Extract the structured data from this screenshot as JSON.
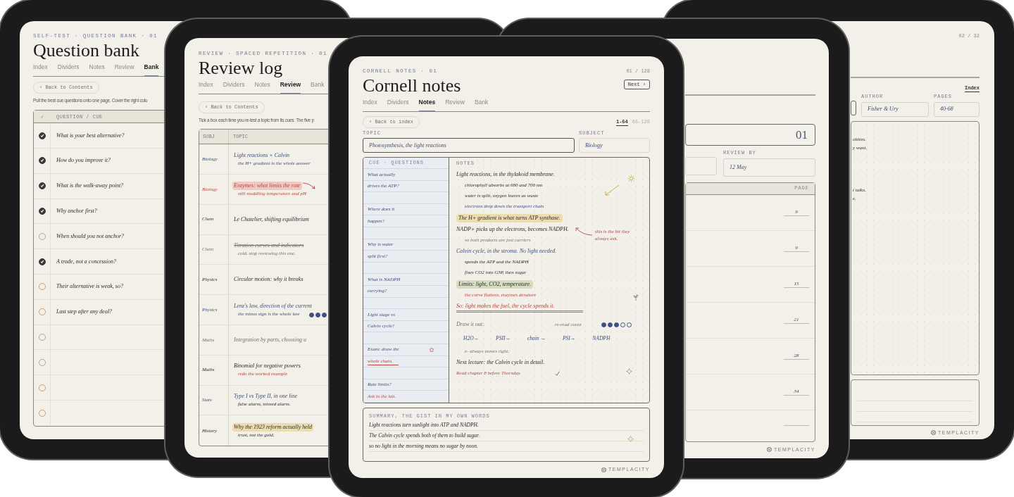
{
  "question_bank": {
    "eyebrow": "SELF-TEST · QUESTION BANK · 01",
    "title": "Question bank",
    "tabs": [
      {
        "label": "Index",
        "selected": false
      },
      {
        "label": "Dividers",
        "selected": false
      },
      {
        "label": "Notes",
        "selected": false
      },
      {
        "label": "Review",
        "selected": false
      },
      {
        "label": "Bank",
        "selected": true
      }
    ],
    "back": "‹ Back to Contents",
    "intro": "Pull the best cue questions onto one page. Cover the right colu",
    "columns": [
      "✓",
      "QUESTION / CUE"
    ],
    "rows": [
      {
        "question": "What is your best alternative?",
        "checked": true
      },
      {
        "question": "How do you improve it?",
        "checked": true
      },
      {
        "question": "What is the walk-away point?",
        "checked": true
      },
      {
        "question": "Why anchor first?",
        "checked": true
      },
      {
        "question": "When should you not anchor?",
        "checked": false
      },
      {
        "question": "A trade, not a concession?",
        "checked": true
      },
      {
        "question": "Their alternative is weak, so?",
        "checked": false
      },
      {
        "question": "Last step after any deal?",
        "checked": false
      },
      {
        "checked": false
      },
      {
        "checked": false
      },
      {
        "checked": false
      },
      {
        "checked": false
      }
    ]
  },
  "review_log": {
    "eyebrow": "REVIEW · SPACED REPETITION · 01",
    "title": "Review log",
    "tabs": [
      {
        "label": "Index",
        "selected": false
      },
      {
        "label": "Dividers",
        "selected": false
      },
      {
        "label": "Notes",
        "selected": false
      },
      {
        "label": "Review",
        "selected": true
      },
      {
        "label": "Bank",
        "selected": false
      }
    ],
    "back": "‹ Back to Contents",
    "intro": "Tick a box each time you re-test a topic from its cues. The five p",
    "columns": [
      "SUBJ",
      "TOPIC"
    ],
    "rows": [
      {
        "subject": "Biology",
        "topic": "Light reactions + Calvin",
        "kind": "active",
        "struck": false,
        "arrow": false,
        "note": {
          "text": "the H+ gradient is the whole answer",
          "kind": "active"
        }
      },
      {
        "subject": "Biology",
        "topic": "Enzymes: what limits the rate",
        "kind": "flagged",
        "struck": false,
        "arrow": true,
        "note": {
          "text": "still muddling temperature and pH",
          "kind": "flagged"
        }
      },
      {
        "subject": "Chem",
        "topic": "Le Chatelier, shifting equilibrium",
        "kind": "plain",
        "struck": false,
        "arrow": false
      },
      {
        "subject": "Chem",
        "topic": "Titration curves and indicators",
        "kind": "faded",
        "struck": true,
        "arrow": false,
        "note": {
          "text": "cold. stop reviewing this one.",
          "kind": "faded"
        }
      },
      {
        "subject": "Physics",
        "topic": "Circular motion: why it breaks",
        "kind": "plain",
        "struck": false,
        "arrow": false
      },
      {
        "subject": "Physics",
        "topic": "Lenz's law, direction of the current",
        "kind": "active",
        "struck": false,
        "arrow": false,
        "note": {
          "text": "the minus sign is the whole law",
          "kind": "active"
        },
        "stars": 3
      },
      {
        "subject": "Maths",
        "topic": "Integration by parts, choosing u",
        "kind": "faded",
        "struck": false,
        "arrow": false
      },
      {
        "subject": "Maths",
        "topic": "Binomial for negative powers",
        "kind": "plain",
        "struck": false,
        "arrow": false,
        "note": {
          "text": "redo the worked example",
          "kind": "flagged"
        }
      },
      {
        "subject": "Stats",
        "topic": "Type I vs Type II, in one line",
        "kind": "active",
        "struck": false,
        "arrow": false,
        "note": {
          "text": "false alarm, missed alarm.",
          "kind": "plain"
        }
      },
      {
        "subject": "History",
        "topic": "Why the 1923 reform actually held",
        "kind": "key",
        "struck": false,
        "arrow": false,
        "note": {
          "text": "trust, not the gold.",
          "kind": "plain"
        }
      }
    ]
  },
  "cornell_notes": {
    "eyebrow": "CORNELL NOTES · 01",
    "page": "01 / 128",
    "title": "Cornell notes",
    "next": "Next ›",
    "tabs": [
      {
        "label": "Index",
        "selected": false
      },
      {
        "label": "Dividers",
        "selected": false
      },
      {
        "label": "Notes",
        "selected": true
      },
      {
        "label": "Review",
        "selected": false
      },
      {
        "label": "Bank",
        "selected": false
      }
    ],
    "back": "‹ Back to index",
    "ranges": [
      {
        "label": "1-64",
        "selected": true
      },
      {
        "label": "65-128",
        "selected": false
      }
    ],
    "topic": {
      "label": "TOPIC",
      "value": "Photosynthesis, the light reactions"
    },
    "subject": {
      "label": "SUBJECT",
      "value": "Biology"
    },
    "cue_header": "CUE · QUESTIONS",
    "cues": [
      {
        "kind": "text",
        "text": "What actually"
      },
      {
        "kind": "text",
        "text": "drives the ATP?"
      },
      {
        "kind": "blank"
      },
      {
        "kind": "text",
        "text": "Where does it"
      },
      {
        "kind": "text",
        "text": "happen?"
      },
      {
        "kind": "blank"
      },
      {
        "kind": "text",
        "text": "Why is water"
      },
      {
        "kind": "text",
        "text": "split first?"
      },
      {
        "kind": "blank"
      },
      {
        "kind": "text",
        "text": "What is NADPH"
      },
      {
        "kind": "text",
        "text": "carrying?"
      },
      {
        "kind": "blank"
      },
      {
        "kind": "text",
        "text": "Light stage vs"
      },
      {
        "kind": "text",
        "text": "Calvin cycle?"
      },
      {
        "kind": "blank"
      },
      {
        "kind": "starred",
        "text": "Exam: draw the"
      },
      {
        "kind": "underlined",
        "text": "whole chain."
      },
      {
        "kind": "blank"
      },
      {
        "kind": "text",
        "text": "Rate limits?"
      },
      {
        "kind": "reminder",
        "text": "Ask in the lab."
      }
    ],
    "notes_header": "NOTES",
    "notes": [
      {
        "kind": "main",
        "text": "Light reactions, in the thylakoid membrane."
      },
      {
        "kind": "sub",
        "text": "chlorophyll absorbs at 680 and 700 nm"
      },
      {
        "kind": "sub",
        "text": "water is split, oxygen leaves as waste"
      },
      {
        "kind": "detail",
        "text": "electrons drop down the transport chain"
      },
      {
        "kind": "keypoint",
        "text": "The H+ gradient is what turns ATP synthase."
      },
      {
        "kind": "main",
        "text": "NADP+ picks up the electrons, becomes NADPH."
      },
      {
        "kind": "aside",
        "text": "so both products are just carriers"
      },
      {
        "kind": "heading",
        "text": "Calvin cycle, in the stroma. No light needed."
      },
      {
        "kind": "sub",
        "text": "spends the ATP and the NADPH"
      },
      {
        "kind": "sub",
        "text": "fixes CO2 into G3P, then sugar"
      },
      {
        "kind": "limits",
        "text": "Limits: light, CO2, temperature."
      },
      {
        "kind": "warning",
        "text": "the curve flattens, enzymes denature"
      },
      {
        "kind": "underlined",
        "text": "So: light makes the fuel, the cycle spends it."
      },
      {
        "kind": "count",
        "text": "Draw it out:",
        "label": "re-read count",
        "stars": 3
      },
      {
        "kind": "chain",
        "steps": [
          "H2O→",
          "PSII→",
          "chain →",
          "PSI→",
          "NADPH"
        ]
      },
      {
        "kind": "aside",
        "text": "e- always moves right."
      },
      {
        "kind": "main",
        "text": "Next lecture: the Calvin cycle in detail."
      },
      {
        "kind": "done",
        "text": "Read chapter 8 before Thursday."
      }
    ],
    "margin_note": "this is the bit they always ask.",
    "summary": {
      "label": "SUMMARY, THE GIST IN MY OWN WORDS",
      "lines": [
        "Light reactions turn sunlight into ATP and NADPH.",
        "The Calvin cycle spends both of them to build sugar.",
        "so no light in the morning means no sugar by noon."
      ]
    },
    "brand": "TEMPLACITY"
  },
  "review_card": {
    "number": "01",
    "review_by": {
      "label": "REVIEW BY",
      "value": "12 May"
    },
    "page_header": "PAGE",
    "pages": [
      "9",
      "9",
      "15",
      "21",
      "28",
      "34"
    ],
    "brand": "TEMPLACITY"
  },
  "book_notes": {
    "page": "02 / 32",
    "index_link": "Index",
    "author": {
      "label": "AUTHOR",
      "value": "Fisher & Ury"
    },
    "pages": {
      "label": "PAGES",
      "value": "40-68"
    },
    "note_groups": [
      {
        "lines": [
          "oblem.",
          "y want."
        ]
      },
      {
        "lines": [
          "t talks.",
          "e."
        ]
      }
    ],
    "brand": "TEMPLACITY"
  }
}
